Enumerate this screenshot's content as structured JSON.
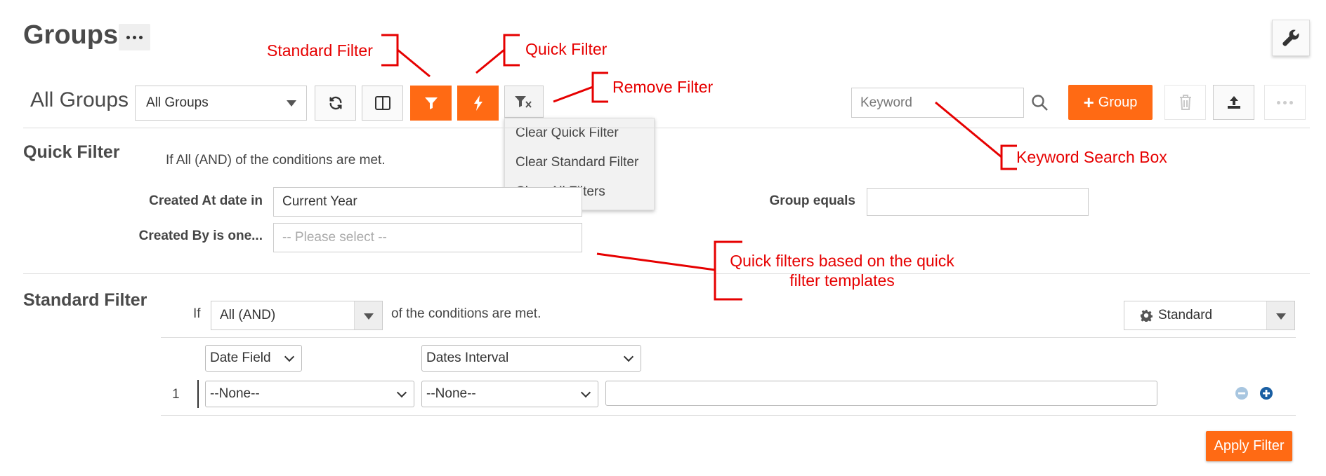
{
  "page": {
    "title": "Groups"
  },
  "toolbar": {
    "view_label": "All Groups",
    "view_select": "All Groups",
    "keyword_placeholder": "Keyword",
    "add_label": "Group"
  },
  "filter_menu": {
    "items": [
      "Clear Quick Filter",
      "Clear Standard Filter",
      "Clear All Filters"
    ]
  },
  "quick_filter": {
    "title": "Quick Filter",
    "condition": "If All (AND) of the conditions are met.",
    "created_at_label": "Created At date in",
    "created_at_value": "Current Year",
    "created_by_label": "Created By is one...",
    "created_by_placeholder": "-- Please select --",
    "group_equals_label": "Group equals",
    "group_equals_value": ""
  },
  "standard_filter": {
    "title": "Standard Filter",
    "if_label": "If",
    "match_select": "All (AND)",
    "condition_suffix": "of the conditions are met.",
    "mode_select": "Standard",
    "date_field": "Date Field",
    "dates_interval": "Dates Interval",
    "rows": [
      {
        "num": "1",
        "field": "--None--",
        "operator": "--None--",
        "value": ""
      }
    ],
    "apply_label": "Apply Filter"
  },
  "annotations": {
    "standard_filter": "Standard Filter",
    "quick_filter": "Quick Filter",
    "remove_filter": "Remove Filter",
    "keyword_search": "Keyword Search Box",
    "quick_templates_line1": "Quick filters based on the quick",
    "quick_templates_line2": "filter templates"
  },
  "colors": {
    "accent": "#ff6a14",
    "annotation": "#e60000",
    "minus_icon": "#a8c6e0",
    "plus_icon": "#1a5fa3"
  }
}
